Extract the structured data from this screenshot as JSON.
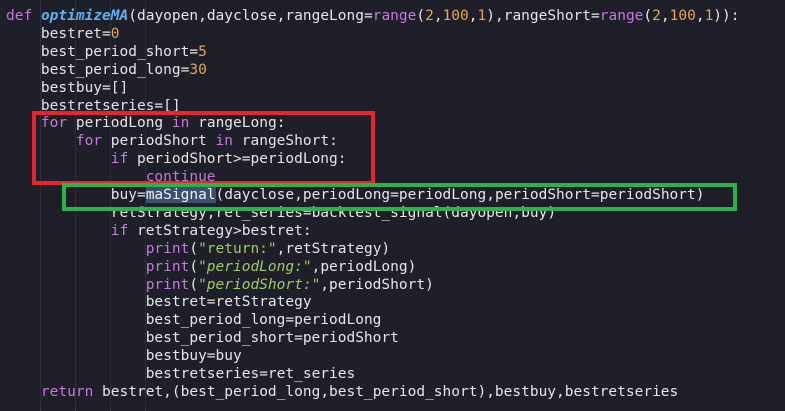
{
  "code_lines": [
    "def optimizeMA(dayopen,dayclose,rangeLong=range(2,100,1),rangeShort=range(2,100,1)):",
    "    bestret=0",
    "    best_period_short=5",
    "    best_period_long=30",
    "    bestbuy=[]",
    "    bestretseries=[]",
    "    for periodLong in rangeLong:",
    "        for periodShort in rangeShort:",
    "            if periodShort>=periodLong:",
    "                continue",
    "            buy=maSignal(dayclose,periodLong=periodLong,periodShort=periodShort)",
    "            retStrategy,ret_series=backtest_signal(dayopen,buy)",
    "            if retStrategy>bestret:",
    "                print(\"return:\",retStrategy)",
    "                print(\"periodLong:\",periodLong)",
    "                print(\"periodShort:\",periodShort)",
    "                bestret=retStrategy",
    "                best_period_long=periodLong",
    "                best_period_short=periodShort",
    "                bestbuy=buy",
    "                bestretseries=ret_series",
    "    return bestret,(best_period_long,best_period_short),bestbuy,bestretseries"
  ],
  "highlighted_token": "maSignal",
  "annotations": [
    {
      "name": "red-box",
      "color": "#e8252d"
    },
    {
      "name": "green-box",
      "color": "#2bb24c"
    }
  ],
  "colors": {
    "background": "#1e1f29",
    "text": "#e6e6e6",
    "keyword": "#c678dd",
    "function": "#61afef",
    "number": "#e5a65b",
    "string": "#9ccc65",
    "selection": "#3b5070"
  }
}
